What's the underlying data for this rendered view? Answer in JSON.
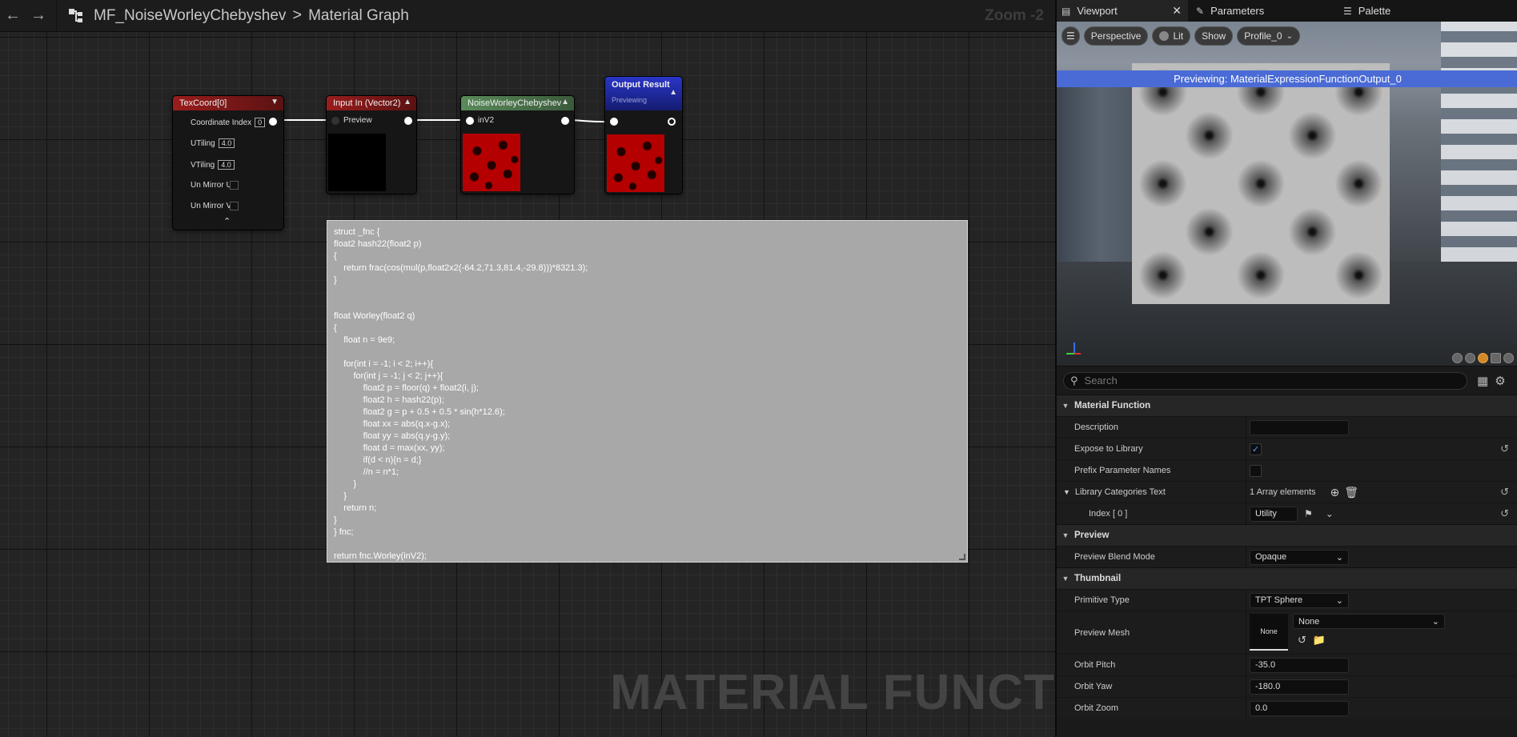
{
  "graph": {
    "back_icon": "arrow-left-icon",
    "forward_icon": "arrow-right-icon",
    "breadcrumb": {
      "asset": "MF_NoiseWorleyChebyshev",
      "separator": ">",
      "graph": "Material Graph"
    },
    "zoom": "Zoom -2",
    "watermark": "MATERIAL FUNCTION"
  },
  "nodes": {
    "texcoord": {
      "title": "TexCoord[0]",
      "coordinate_index_label": "Coordinate Index",
      "coordinate_index_value": "0",
      "utiling_label": "UTiling",
      "utiling_value": "4.0",
      "vtiling_label": "VTiling",
      "vtiling_value": "4.0",
      "unmirror_u_label": "Un Mirror U",
      "unmirror_v_label": "Un Mirror V",
      "header_color": "#8b1a1a"
    },
    "input": {
      "title": "Input In (Vector2)",
      "preview_label": "Preview",
      "header_color": "#8b1a1a"
    },
    "noise": {
      "title": "NoiseWorleyChebyshev",
      "pin_label": "inV2",
      "header_color": "#4f7a4f"
    },
    "output": {
      "title": "Output Result",
      "subtitle": "Previewing",
      "header_color": "#1e2a9a"
    }
  },
  "code": {
    "text": "struct _fnc {\nfloat2 hash22(float2 p)\n{\n    return frac(cos(mul(p,float2x2(-64.2,71.3,81.4,-29.8)))*8321.3);\n}\n\n\nfloat Worley(float2 q)\n{\n    float n = 9e9;\n\n    for(int i = -1; i < 2; i++){\n        for(int j = -1; j < 2; j++){\n            float2 p = floor(q) + float2(i, j);\n            float2 h = hash22(p);\n            float2 g = p + 0.5 + 0.5 * sin(h*12.6);\n            float xx = abs(q.x-g.x);\n            float yy = abs(q.y-g.y);\n            float d = max(xx, yy);\n            if(d < n){n = d;}\n            //n = n*1;\n        }\n    }\n    return n;\n}\n} fnc;\n\nreturn fnc.Worley(inV2);"
  },
  "tabs": {
    "viewport": "Viewport",
    "parameters": "Parameters",
    "palette": "Palette"
  },
  "viewport": {
    "perspective": "Perspective",
    "lit": "Lit",
    "show": "Show",
    "profile": "Profile_0",
    "previewing": "Previewing: MaterialExpressionFunctionOutput_0"
  },
  "details": {
    "search_placeholder": "Search",
    "sections": {
      "material_function": "Material Function",
      "preview": "Preview",
      "thumbnail": "Thumbnail"
    },
    "props": {
      "description": "Description",
      "description_value": "",
      "expose_to_library": "Expose to Library",
      "expose_to_library_checked": true,
      "prefix_parameter_names": "Prefix Parameter Names",
      "prefix_parameter_names_checked": false,
      "library_categories_text": "Library Categories Text",
      "array_elements": "1 Array elements",
      "index_0": "Index [ 0 ]",
      "index_0_value": "Utility",
      "preview_blend_mode": "Preview Blend Mode",
      "preview_blend_mode_value": "Opaque",
      "primitive_type": "Primitive Type",
      "primitive_type_value": "TPT Sphere",
      "preview_mesh": "Preview Mesh",
      "preview_mesh_thumb": "None",
      "preview_mesh_value": "None",
      "orbit_pitch": "Orbit Pitch",
      "orbit_pitch_value": "-35.0",
      "orbit_yaw": "Orbit Yaw",
      "orbit_yaw_value": "-180.0",
      "orbit_zoom": "Orbit Zoom",
      "orbit_zoom_value": "0.0"
    }
  }
}
